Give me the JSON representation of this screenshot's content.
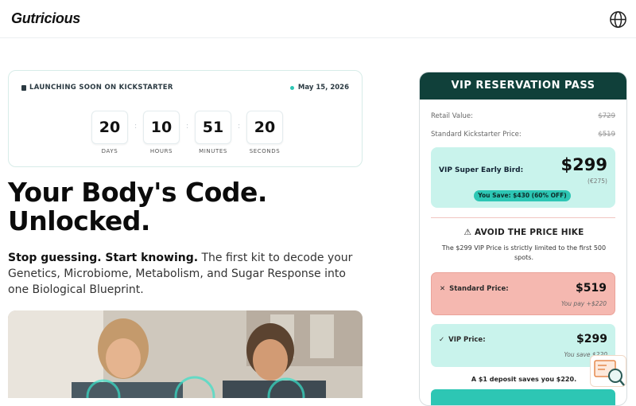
{
  "brand": {
    "name": "Gutricious"
  },
  "header": {
    "globe_icon": "globe-icon"
  },
  "countdown": {
    "launch_label": "LAUNCHING SOON ON KICKSTARTER",
    "date": "May 15, 2026",
    "units": [
      {
        "value": "20",
        "label": "DAYS"
      },
      {
        "value": "10",
        "label": "HOURS"
      },
      {
        "value": "51",
        "label": "MINUTES"
      },
      {
        "value": "20",
        "label": "SECONDS"
      }
    ]
  },
  "hero": {
    "headline_line1": "Your Body's Code.",
    "headline_line2": "Unlocked.",
    "sub_bold": "Stop guessing. Start knowing.",
    "sub_rest": " The first kit to decode your Genetics, Microbiome, Metabolism, and Sugar Response into one Biological Blueprint."
  },
  "pricing": {
    "title": "VIP RESERVATION PASS",
    "retail_label": "Retail Value:",
    "retail_value": "$729",
    "standard_ks_label": "Standard Kickstarter Price:",
    "standard_ks_value": "$519",
    "vip_label": "VIP Super Early Bird:",
    "vip_price": "$299",
    "vip_eur": "(€275)",
    "vip_save": "You Save: $430 (60% OFF)",
    "avoid_title": "AVOID THE PRICE HIKE",
    "avoid_text": "The $299 VIP Price is strictly limited to the first 500 spots.",
    "standard_label": "Standard Price:",
    "standard_price": "$519",
    "standard_note": "You pay +$220",
    "vip2_label": "VIP Price:",
    "vip2_price": "$299",
    "vip2_note": "You save $220",
    "deposit": "A $1 deposit saves you $220."
  },
  "colors": {
    "accent": "#2dc6b4",
    "dark_green": "#10403a",
    "warning_bg": "#f5b8b0",
    "vip_bg": "#c9f3ec"
  }
}
